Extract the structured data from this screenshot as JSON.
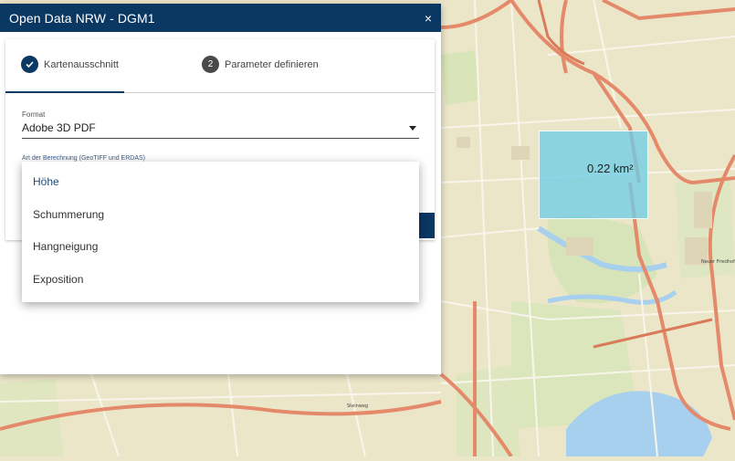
{
  "dialog": {
    "title": "Open Data NRW - DGM1",
    "close_symbol": "×"
  },
  "stepper": {
    "step1": {
      "label": "Kartenausschnitt",
      "status": "done",
      "icon": "check-icon"
    },
    "step2": {
      "label": "Parameter definieren",
      "number": "2"
    }
  },
  "format": {
    "label": "Format",
    "value": "Adobe 3D PDF"
  },
  "calculation": {
    "label": "Art der Berechnung (GeoTIFF und ERDAS)"
  },
  "dropdown": {
    "options": [
      "Höhe",
      "Schummerung",
      "Hangneigung",
      "Exposition"
    ],
    "selected": "Höhe"
  },
  "map": {
    "area_label": "0.22 km²",
    "selection_color": "#6ecde6",
    "place_label_1": "Neuer Friedhof",
    "place_label_2": "Steinweg"
  },
  "colors": {
    "header": "#0b3763",
    "accent": "#0b3763"
  }
}
